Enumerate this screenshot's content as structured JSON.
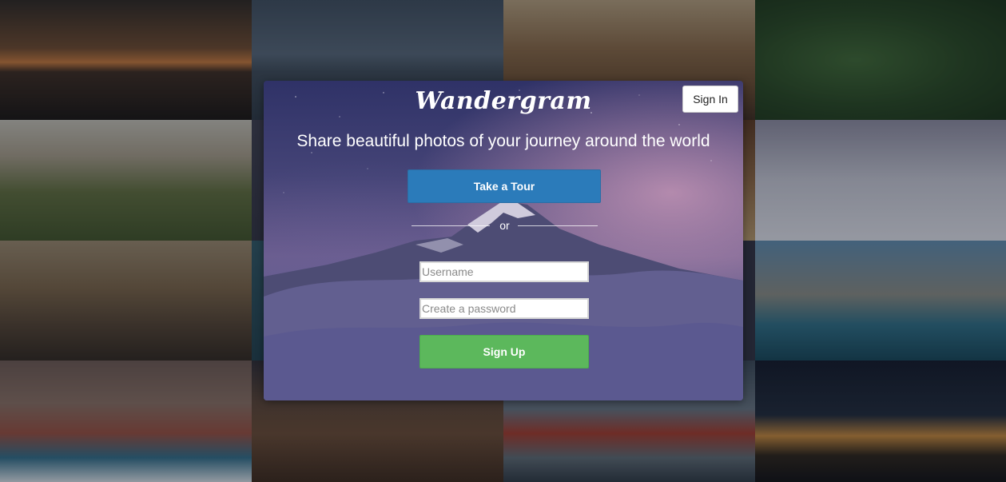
{
  "brand": {
    "name": "Wandergram"
  },
  "header": {
    "signin_label": "Sign In"
  },
  "hero": {
    "tagline": "Share beautiful photos of your journey around the world"
  },
  "actions": {
    "tour_label": "Take a Tour",
    "divider_text": "or",
    "signup_label": "Sign Up"
  },
  "form": {
    "username": {
      "value": "",
      "placeholder": "Username"
    },
    "password": {
      "value": "",
      "placeholder": "Create a password"
    }
  },
  "background_tiles": [
    "baobab-sunset-photo",
    "alcatraz-bay-photo",
    "cactus-field-photo",
    "river-forest-aerial-photo",
    "elephant-savanna-photo",
    "dark-photo",
    "fishermans-wharf-photo",
    "snow-cabin-photo",
    "coastal-town-aerial-photo",
    "teal-photo",
    "dark-photo-2",
    "sea-arches-photo",
    "cliff-houses-aerial-photo",
    "mountain-ridge-photo",
    "golden-gate-bridge-photo",
    "palace-fine-arts-night-photo"
  ],
  "colors": {
    "tour_button": "#2b7bba",
    "signup_button": "#5cb85c",
    "panel_top": "#2f3267"
  }
}
